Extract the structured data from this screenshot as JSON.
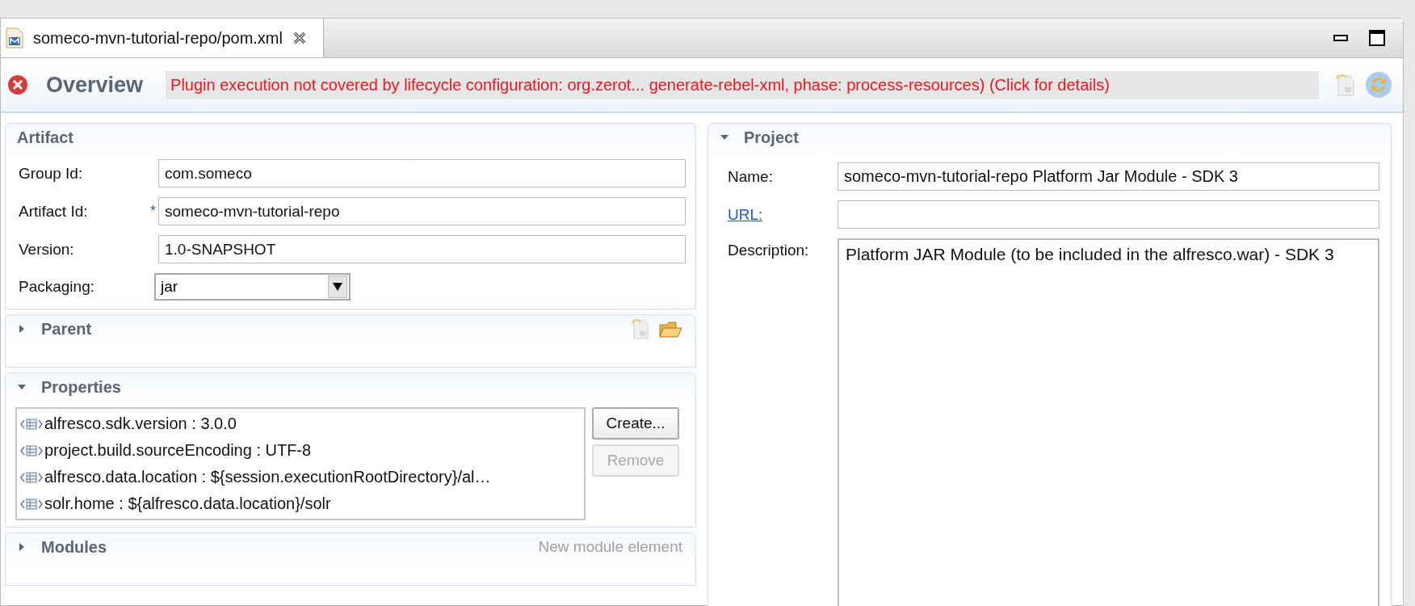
{
  "tab": {
    "label": "someco-mvn-tutorial-repo/pom.xml",
    "selected": true
  },
  "header": {
    "title": "Overview",
    "error": true,
    "message": "Plugin execution not covered by lifecycle configuration: org.zerot... generate-rebel-xml, phase: process-resources) (Click for details)"
  },
  "artifact": {
    "title": "Artifact",
    "fields": [
      {
        "label": "Group Id:",
        "value": "com.someco",
        "kind": "text"
      },
      {
        "label": "Artifact Id:",
        "value": "someco-mvn-tutorial-repo",
        "kind": "text",
        "required_mark": "*"
      },
      {
        "label": "Version:",
        "value": "1.0-SNAPSHOT",
        "kind": "text"
      },
      {
        "label": "Packaging:",
        "value": "jar",
        "kind": "select"
      }
    ]
  },
  "parent": {
    "title": "Parent",
    "expanded": false
  },
  "properties": {
    "title": "Properties",
    "expanded": true,
    "items": [
      "alfresco.sdk.version : 3.0.0",
      "project.build.sourceEncoding : UTF-8",
      "alfresco.data.location : ${session.executionRootDirectory}/al…",
      "solr.home : ${alfresco.data.location}/solr"
    ],
    "buttons": [
      {
        "label": "Create...",
        "disabled": false
      },
      {
        "label": "Remove",
        "disabled": true
      }
    ]
  },
  "modules": {
    "title": "Modules",
    "expanded": false,
    "action": "New module element"
  },
  "project": {
    "title": "Project",
    "expanded": true,
    "fields": [
      {
        "label": "Name:",
        "value": "someco-mvn-tutorial-repo Platform Jar Module - SDK 3",
        "kind": "text"
      },
      {
        "label": "URL:",
        "kind": "link"
      },
      {
        "label": "Description:",
        "value": "Platform JAR Module (to be included in the alfresco.war) - SDK 3",
        "kind": "area"
      }
    ]
  }
}
